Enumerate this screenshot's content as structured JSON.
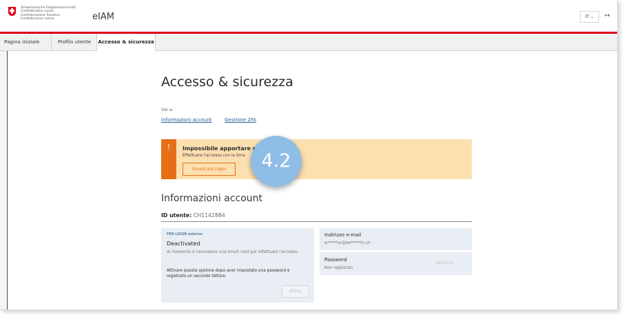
{
  "header": {
    "confederation_lines": [
      "Schweizerische Eidgenossenschaft",
      "Confédération suisse",
      "Confederazione Svizzera",
      "Confederaziun svizra"
    ],
    "app_title": "eIAM",
    "language": "IT",
    "language_icon": "chevron-down-icon",
    "logout_icon": "logout-icon",
    "brand_color": "#dc0018"
  },
  "tabs": [
    {
      "label": "Pagina iniziale"
    },
    {
      "label": "Profilo utente"
    },
    {
      "label": "Accesso & sicurezza",
      "active": true
    }
  ],
  "main": {
    "title": "Accesso & sicurezza",
    "goto_label": "Vai a:",
    "links": [
      "Informazioni account",
      "Gestione 2FA"
    ]
  },
  "alert": {
    "icon": "!",
    "title": "Impossibile apportare m",
    "text": "Effettuare l'accesso con la Sma",
    "button": "Smartcard Login",
    "color": "#e46f15",
    "background": "#fde0b0"
  },
  "badge": {
    "text": "4.2",
    "color": "#8ebde6"
  },
  "account": {
    "section_title": "Informazioni account",
    "user_id_label": "ID utente:",
    "user_id_value": "CH1142884",
    "fed_login": {
      "label": "FED-LOGIN esterno",
      "status": "Deactivated",
      "description": "Al momento è necessaria una smart card per effettuare l'accesso.",
      "note": "Attivare questa opzione dopo aver impostato una password e registrato un secondo fattore.",
      "button": "Attiva"
    },
    "email": {
      "label": "Indirizzo e-mail",
      "value": "w*****er@be*****in.ch"
    },
    "password": {
      "label": "Password",
      "value": "Non registrato",
      "button": "Registra"
    }
  }
}
